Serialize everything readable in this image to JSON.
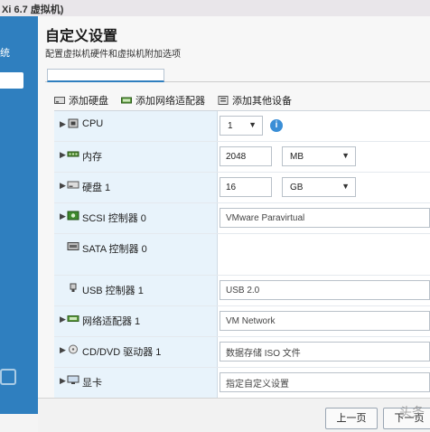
{
  "window": {
    "title": "Xi 6.7 虚拟机)"
  },
  "wizard": {
    "side_text": "统"
  },
  "page": {
    "title": "自定义设置",
    "subtitle": "配置虚拟机硬件和虚拟机附加选项"
  },
  "toolbar": {
    "add_disk": "添加硬盘",
    "add_network": "添加网络适配器",
    "add_other": "添加其他设备"
  },
  "hardware": [
    {
      "name": "CPU",
      "icon": "cpu-icon",
      "expandable": true,
      "value": "1",
      "has_info": true
    },
    {
      "name": "内存",
      "icon": "memory-icon",
      "expandable": true,
      "value": "2048",
      "unit": "MB"
    },
    {
      "name": "硬盘 1",
      "icon": "disk-icon",
      "expandable": true,
      "value": "16",
      "unit": "GB"
    },
    {
      "name": "SCSI 控制器 0",
      "icon": "scsi-icon",
      "expandable": true,
      "value": "VMware Paravirtual"
    },
    {
      "name": "SATA 控制器 0",
      "icon": "sata-icon",
      "expandable": false,
      "value": ""
    },
    {
      "name": "USB 控制器 1",
      "icon": "usb-icon",
      "expandable": false,
      "value": "USB 2.0"
    },
    {
      "name": "网络适配器 1",
      "icon": "network-icon",
      "expandable": true,
      "value": "VM Network"
    },
    {
      "name": "CD/DVD 驱动器 1",
      "icon": "cdrom-icon",
      "expandable": true,
      "value": "数据存储 ISO 文件"
    },
    {
      "name": "显卡",
      "icon": "display-icon",
      "expandable": true,
      "value": "指定自定义设置"
    }
  ],
  "footer": {
    "back": "上一页",
    "next": "下一页"
  },
  "watermark": "头条"
}
